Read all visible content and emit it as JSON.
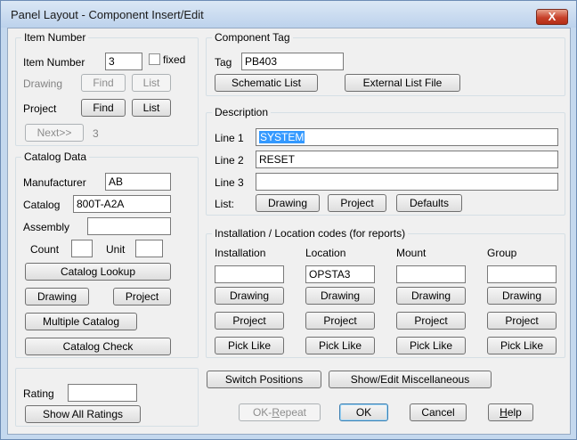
{
  "window": {
    "title": "Panel Layout - Component Insert/Edit",
    "close_label": "X"
  },
  "item_number": {
    "group_title": "Item Number",
    "item_number_label": "Item Number",
    "item_number_value": "3",
    "fixed_label": "fixed",
    "fixed_checked": false,
    "drawing_label": "Drawing",
    "find_label": "Find",
    "list_label": "List",
    "project_label": "Project",
    "next_label": "Next>>",
    "next_value": "3"
  },
  "catalog": {
    "group_title": "Catalog Data",
    "manufacturer_label": "Manufacturer",
    "manufacturer_value": "AB",
    "catalog_label": "Catalog",
    "catalog_value": "800T-A2A",
    "assembly_label": "Assembly",
    "assembly_value": "",
    "count_label": "Count",
    "count_value": "",
    "unit_label": "Unit",
    "unit_value": "",
    "catalog_lookup_label": "Catalog Lookup",
    "drawing_label": "Drawing",
    "project_label": "Project",
    "multiple_catalog_label": "Multiple Catalog",
    "catalog_check_label": "Catalog Check"
  },
  "rating": {
    "rating_label": "Rating",
    "rating_value": "",
    "show_all_label": "Show All Ratings"
  },
  "component_tag": {
    "group_title": "Component Tag",
    "tag_label": "Tag",
    "tag_value": "PB403",
    "schematic_list_label": "Schematic List",
    "external_list_label": "External List File"
  },
  "description": {
    "group_title": "Description",
    "line1_label": "Line 1",
    "line1_value": "SYSTEM",
    "line2_label": "Line 2",
    "line2_value": "RESET",
    "line3_label": "Line 3",
    "line3_value": "",
    "list_label": "List:",
    "drawing_label": "Drawing",
    "project_label": "Project",
    "defaults_label": "Defaults"
  },
  "location_codes": {
    "group_title": "Installation / Location codes  (for reports)",
    "drawing_label": "Drawing",
    "project_label": "Project",
    "pick_like_label": "Pick Like",
    "columns": [
      {
        "header": "Installation",
        "value": ""
      },
      {
        "header": "Location",
        "value": "OPSTA3"
      },
      {
        "header": "Mount",
        "value": ""
      },
      {
        "header": "Group",
        "value": ""
      }
    ]
  },
  "bottom": {
    "switch_positions_label": "Switch Positions",
    "show_edit_misc_label": "Show/Edit Miscellaneous",
    "ok_repeat_prefix": "OK-",
    "ok_repeat_underlined": "R",
    "ok_repeat_suffix": "epeat",
    "ok_label": "OK",
    "cancel_label": "Cancel",
    "help_underlined": "H",
    "help_suffix": "elp"
  },
  "icons": {
    "close": "close-icon",
    "checkbox": "checkbox-icon"
  }
}
